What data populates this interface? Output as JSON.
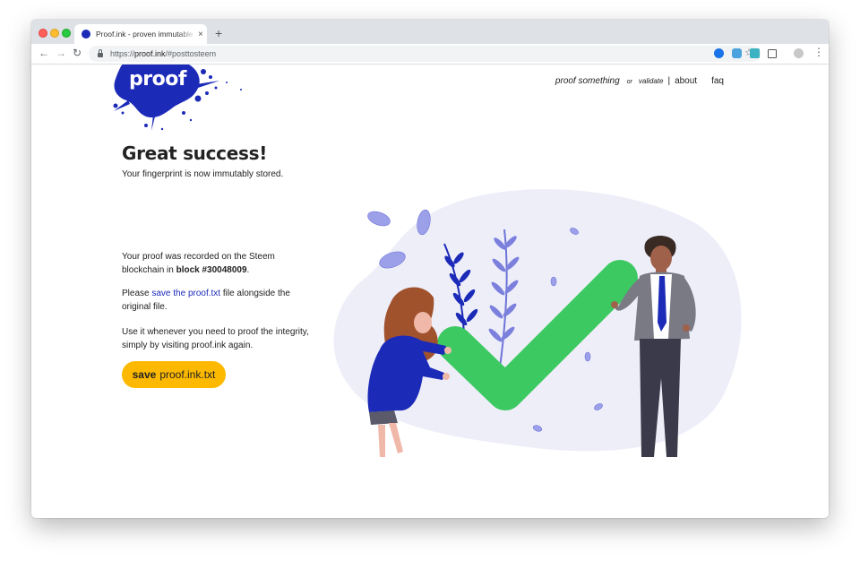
{
  "browser": {
    "tab_title": "Proof.ink - proven immutable fingerprints",
    "new_tab_label": "+",
    "tab_close_label": "×",
    "url_prefix": "https://",
    "url_host": "proof.ink",
    "url_path": "/#posttosteem"
  },
  "nav": {
    "proof_something": "proof something",
    "or": "or",
    "validate": "validate",
    "separator": "|",
    "about": "about",
    "faq": "faq"
  },
  "logo": {
    "text": "proof"
  },
  "main": {
    "title": "Great success!",
    "subtitle": "Your fingerprint is now immutably stored.",
    "recorded_pre": "Your proof was recorded on the Steem blockchain in ",
    "block_label": "block #30048009",
    "recorded_post": ".",
    "please": "Please ",
    "save_link": "save the proof.txt",
    "save_post": " file alongside the original file.",
    "use_text": "Use it whenever you need to proof the integrity, simply by visiting proof.ink again."
  },
  "save_button": {
    "strong": "save",
    "rest": "proof.ink.txt"
  },
  "colors": {
    "brand_blue": "#1c2ab8",
    "save_yellow": "#fcb900",
    "check_green": "#3dc962",
    "blob_bg": "#eeeef9"
  }
}
